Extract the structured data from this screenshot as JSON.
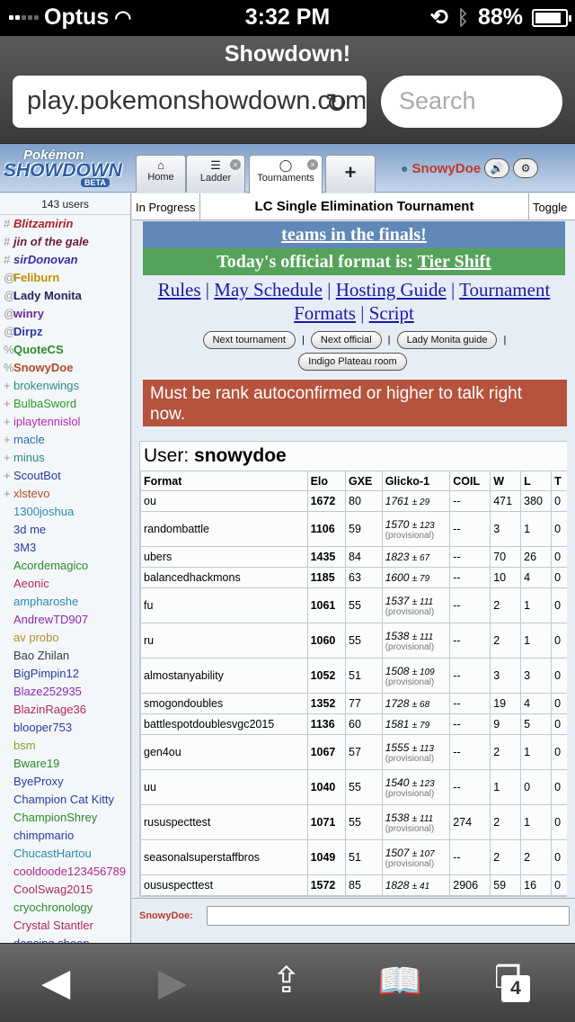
{
  "status": {
    "carrier": "Optus",
    "time": "3:32 PM",
    "battery": "88%"
  },
  "browser": {
    "title": "Showdown!",
    "url": "play.pokemonshowdown.com",
    "search_placeholder": "Search"
  },
  "tabs": {
    "home": "Home",
    "ladder": "Ladder",
    "tournaments": "Tournaments"
  },
  "logo": {
    "pokemon": "Pokémon",
    "showdown": "SHOWDOWN",
    "beta": "BETA"
  },
  "user": {
    "name": "SnowyDoe"
  },
  "userlist": {
    "count": "143 users",
    "users": [
      {
        "sym": "#",
        "name": "Blitzamirin",
        "color": "#b0202a",
        "style": "bi"
      },
      {
        "sym": "#",
        "name": "jin of the gale",
        "color": "#6a1a3a",
        "style": "bi"
      },
      {
        "sym": "#",
        "name": "sirDonovan",
        "color": "#3a2aa0",
        "style": "bi"
      },
      {
        "sym": "@",
        "name": "Feliburn",
        "color": "#c09000",
        "style": "b"
      },
      {
        "sym": "@",
        "name": "Lady Monita",
        "color": "#262660",
        "style": "b"
      },
      {
        "sym": "@",
        "name": "winry",
        "color": "#6a2a9a",
        "style": "b"
      },
      {
        "sym": "@",
        "name": "Dirpz",
        "color": "#2a3aa0",
        "style": "b"
      },
      {
        "sym": "%",
        "name": "QuoteCS",
        "color": "#2a8a2a",
        "style": "b"
      },
      {
        "sym": "%",
        "name": "SnowyDoe",
        "color": "#b04a2a",
        "style": "b"
      },
      {
        "sym": "+",
        "name": "brokenwings",
        "color": "#2a8a8a",
        "style": ""
      },
      {
        "sym": "+",
        "name": "BulbaSword",
        "color": "#2a9a2a",
        "style": ""
      },
      {
        "sym": "+",
        "name": "iplaytennislol",
        "color": "#b02ab0",
        "style": ""
      },
      {
        "sym": "+",
        "name": "macle",
        "color": "#2a6ab0",
        "style": ""
      },
      {
        "sym": "+",
        "name": "minus",
        "color": "#2a8a8a",
        "style": ""
      },
      {
        "sym": "+",
        "name": "ScoutBot",
        "color": "#2a3aa0",
        "style": ""
      },
      {
        "sym": "+",
        "name": "xlstevo",
        "color": "#b04a2a",
        "style": ""
      },
      {
        "sym": "",
        "name": "1300joshua",
        "color": "#2a8ab0",
        "style": ""
      },
      {
        "sym": "",
        "name": "3d me",
        "color": "#2a3aa0",
        "style": ""
      },
      {
        "sym": "",
        "name": "3M3",
        "color": "#2a3aa0",
        "style": ""
      },
      {
        "sym": "",
        "name": "Acordemagico",
        "color": "#2a8a2a",
        "style": ""
      },
      {
        "sym": "",
        "name": "Aeonic",
        "color": "#b02a5a",
        "style": ""
      },
      {
        "sym": "",
        "name": "ampharoshe",
        "color": "#2a8ab0",
        "style": ""
      },
      {
        "sym": "",
        "name": "AndrewTD907",
        "color": "#8a2ab0",
        "style": ""
      },
      {
        "sym": "",
        "name": "av probo",
        "color": "#b0902a",
        "style": ""
      },
      {
        "sym": "",
        "name": "Bao Zhilan",
        "color": "#3a3a3a",
        "style": ""
      },
      {
        "sym": "",
        "name": "BigPimpin12",
        "color": "#2a3aa0",
        "style": ""
      },
      {
        "sym": "",
        "name": "Blaze252935",
        "color": "#8a2ab0",
        "style": ""
      },
      {
        "sym": "",
        "name": "BlazinRage36",
        "color": "#b02a5a",
        "style": ""
      },
      {
        "sym": "",
        "name": "blooper753",
        "color": "#2a3aa0",
        "style": ""
      },
      {
        "sym": "",
        "name": "bsm",
        "color": "#8aa02a",
        "style": ""
      },
      {
        "sym": "",
        "name": "Bware19",
        "color": "#2a8a2a",
        "style": ""
      },
      {
        "sym": "",
        "name": "ByeProxy",
        "color": "#2a3aa0",
        "style": ""
      },
      {
        "sym": "",
        "name": "Champion Cat Kitty",
        "color": "#2a3aa0",
        "style": ""
      },
      {
        "sym": "",
        "name": "ChampionShrey",
        "color": "#2a8a2a",
        "style": ""
      },
      {
        "sym": "",
        "name": "chimpmario",
        "color": "#2a3aa0",
        "style": ""
      },
      {
        "sym": "",
        "name": "ChucastHartou",
        "color": "#2a8ab0",
        "style": ""
      },
      {
        "sym": "",
        "name": "cooldoode123456789",
        "color": "#b02a8a",
        "style": ""
      },
      {
        "sym": "",
        "name": "CoolSwag2015",
        "color": "#b02a5a",
        "style": ""
      },
      {
        "sym": "",
        "name": "cryochronology",
        "color": "#2a8a2a",
        "style": ""
      },
      {
        "sym": "",
        "name": "Crystal Stantler",
        "color": "#b02a5a",
        "style": ""
      },
      {
        "sym": "",
        "name": "dancing sheep",
        "color": "#2a3aa0",
        "style": ""
      }
    ]
  },
  "room": {
    "status": "In Progress",
    "title": "LC Single Elimination Tournament",
    "toggle": "Toggle",
    "banner1": "teams in the finals!",
    "format_prefix": "Today's official format is: ",
    "format": "Tier Shift",
    "links": [
      "Rules",
      "May Schedule",
      "Hosting Guide",
      "Tournament Formats",
      "Script"
    ],
    "buttons": [
      "Next tournament",
      "Next official",
      "Lady Monita guide",
      "Indigo Plateau room"
    ],
    "error": "Must be rank autoconfirmed or higher to talk right now."
  },
  "ladder": {
    "user_label": "User:",
    "user": "snowydoe",
    "headers": [
      "Format",
      "Elo",
      "GXE",
      "Glicko-1",
      "COIL",
      "W",
      "L",
      "T"
    ],
    "rows": [
      [
        "ou",
        "1672",
        "80",
        "1761",
        "± 29",
        "",
        "--",
        "471",
        "380",
        "0"
      ],
      [
        "randombattle",
        "1106",
        "59",
        "1570",
        "± 123",
        "(provisional)",
        "--",
        "3",
        "1",
        "0"
      ],
      [
        "ubers",
        "1435",
        "84",
        "1823",
        "± 67",
        "",
        "--",
        "70",
        "26",
        "0"
      ],
      [
        "balancedhackmons",
        "1185",
        "63",
        "1600",
        "± 79",
        "",
        "--",
        "10",
        "4",
        "0"
      ],
      [
        "fu",
        "1061",
        "55",
        "1537",
        "± 111",
        "(provisional)",
        "--",
        "2",
        "1",
        "0"
      ],
      [
        "ru",
        "1060",
        "55",
        "1538",
        "± 111",
        "(provisional)",
        "--",
        "2",
        "1",
        "0"
      ],
      [
        "almostanyability",
        "1052",
        "51",
        "1508",
        "± 109",
        "(provisional)",
        "--",
        "3",
        "3",
        "0"
      ],
      [
        "smogondoubles",
        "1352",
        "77",
        "1728",
        "± 68",
        "",
        "--",
        "19",
        "4",
        "0"
      ],
      [
        "battlespotdoublesvgc2015",
        "1136",
        "60",
        "1581",
        "± 79",
        "",
        "--",
        "9",
        "5",
        "0"
      ],
      [
        "gen4ou",
        "1067",
        "57",
        "1555",
        "± 113",
        "(provisional)",
        "--",
        "2",
        "1",
        "0"
      ],
      [
        "uu",
        "1040",
        "55",
        "1540",
        "± 123",
        "(provisional)",
        "--",
        "1",
        "0",
        "0"
      ],
      [
        "rususpecttest",
        "1071",
        "55",
        "1538",
        "± 111",
        "(provisional)",
        "274",
        "2",
        "1",
        "0"
      ],
      [
        "seasonalsuperstaffbros",
        "1049",
        "51",
        "1507",
        "± 107",
        "(provisional)",
        "--",
        "2",
        "2",
        "0"
      ],
      [
        "oususpecttest",
        "1572",
        "85",
        "1828",
        "± 41",
        "",
        "2906",
        "59",
        "16",
        "0"
      ]
    ]
  },
  "chat": {
    "prompt": "SnowyDoe:"
  },
  "toolbar": {
    "tabs_count": "4"
  }
}
